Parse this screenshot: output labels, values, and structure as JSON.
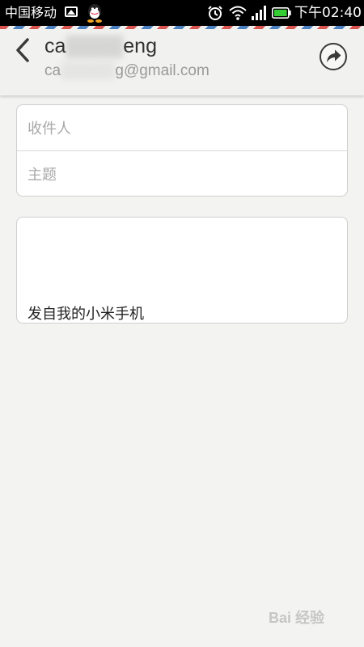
{
  "status_bar": {
    "carrier": "中国移动",
    "time": "下午02:40",
    "icons": [
      "gallery-icon",
      "qq-icon",
      "alarm-icon",
      "wifi-icon",
      "signal-icon",
      "battery-icon"
    ]
  },
  "header": {
    "sender_name_visible_prefix": "ca",
    "sender_name_visible_suffix": "eng",
    "sender_email_visible_prefix": "ca",
    "sender_email_visible_suffix": "g@gmail.com",
    "back_icon": "chevron-left-icon",
    "send_icon": "send-arrow-icon"
  },
  "form": {
    "to_placeholder": "收件人",
    "subject_placeholder": "主题",
    "signature": "发自我的小米手机"
  },
  "watermark": {
    "text": "Bai 经验"
  },
  "colors": {
    "status_bar_bg": "#000000",
    "page_bg": "#f3f3f1",
    "battery_green": "#33cc33",
    "airmail_red": "#d9534f",
    "airmail_blue": "#4a7fc1"
  }
}
